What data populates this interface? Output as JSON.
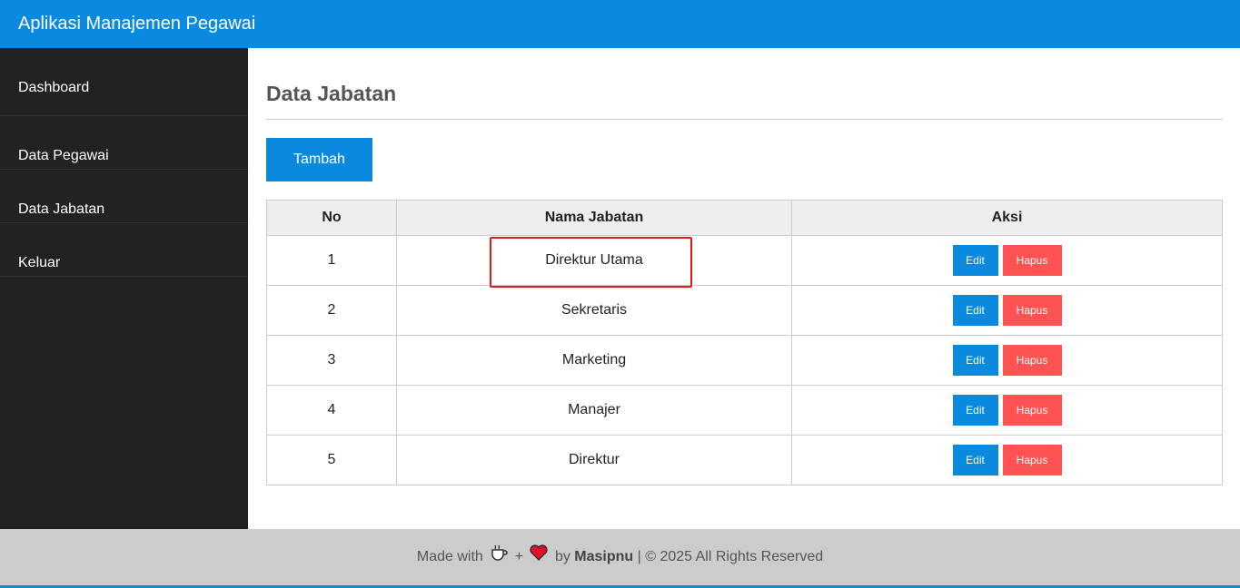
{
  "header": {
    "title": "Aplikasi Manajemen Pegawai"
  },
  "sidebar": {
    "items": [
      {
        "label": "Dashboard"
      },
      {
        "label": "Data Pegawai"
      },
      {
        "label": "Data Jabatan"
      },
      {
        "label": "Keluar"
      }
    ]
  },
  "main": {
    "title": "Data Jabatan",
    "add_label": "Tambah",
    "table": {
      "headers": [
        "No",
        "Nama Jabatan",
        "Aksi"
      ],
      "rows": [
        {
          "no": "1",
          "name": "Direktur Utama"
        },
        {
          "no": "2",
          "name": "Sekretaris"
        },
        {
          "no": "3",
          "name": "Marketing"
        },
        {
          "no": "4",
          "name": "Manajer"
        },
        {
          "no": "5",
          "name": "Direktur"
        }
      ],
      "edit_label": "Edit",
      "delete_label": "Hapus"
    }
  },
  "footer": {
    "prefix": "Made with",
    "plus": "+",
    "by": "by",
    "author": "Masipnu",
    "suffix": "| © 2025 All Rights Reserved",
    "icons": [
      "coffee-icon",
      "heart-icon"
    ]
  },
  "colors": {
    "primary": "#0a8ade",
    "danger": "#ff5252",
    "sidebar": "#222222",
    "highlight": "#e01b1b"
  }
}
